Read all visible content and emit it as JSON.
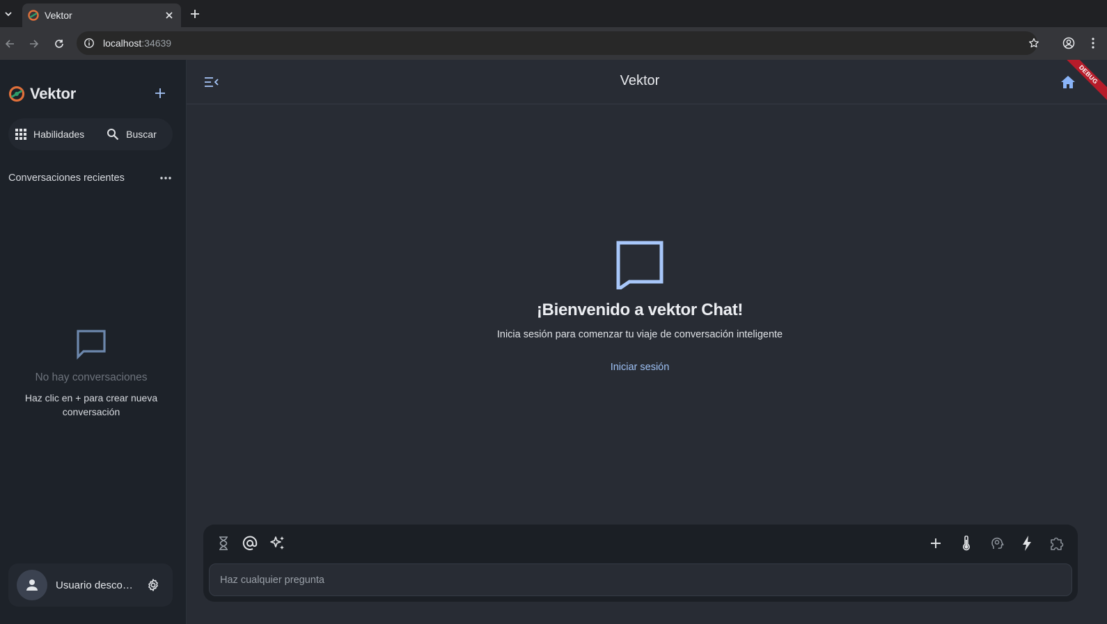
{
  "browser": {
    "tab_title": "Vektor",
    "url_host": "localhost",
    "url_port": ":34639"
  },
  "sidebar": {
    "brand_name": "Vektor",
    "quick_actions": [
      {
        "label": "Habilidades",
        "icon": "grid-icon"
      },
      {
        "label": "Buscar",
        "icon": "search-icon"
      }
    ],
    "recent_title": "Conversaciones recientes",
    "empty_title": "No hay conversaciones",
    "empty_subtitle": "Haz clic en + para crear nueva conversación",
    "user_name": "Usuario desconocido"
  },
  "header": {
    "title": "Vektor",
    "debug_label": "DEBUG"
  },
  "welcome": {
    "title": "¡Bienvenido a vektor Chat!",
    "subtitle": "Inicia sesión para comenzar tu viaje de conversación inteligente",
    "login_link": "Iniciar sesión"
  },
  "composer": {
    "placeholder": "Haz cualquier pregunta",
    "left_tools": [
      "hourglass-icon",
      "at-sign-icon",
      "sparkles-icon"
    ],
    "right_tools": [
      "plus-icon",
      "thermometer-icon",
      "brain-icon",
      "bolt-icon",
      "puzzle-icon"
    ]
  },
  "colors": {
    "accent": "#9ec1f5",
    "sidebar_bg": "#1d2229",
    "main_bg": "#282c34",
    "debug_ribbon": "#b71c2a"
  }
}
